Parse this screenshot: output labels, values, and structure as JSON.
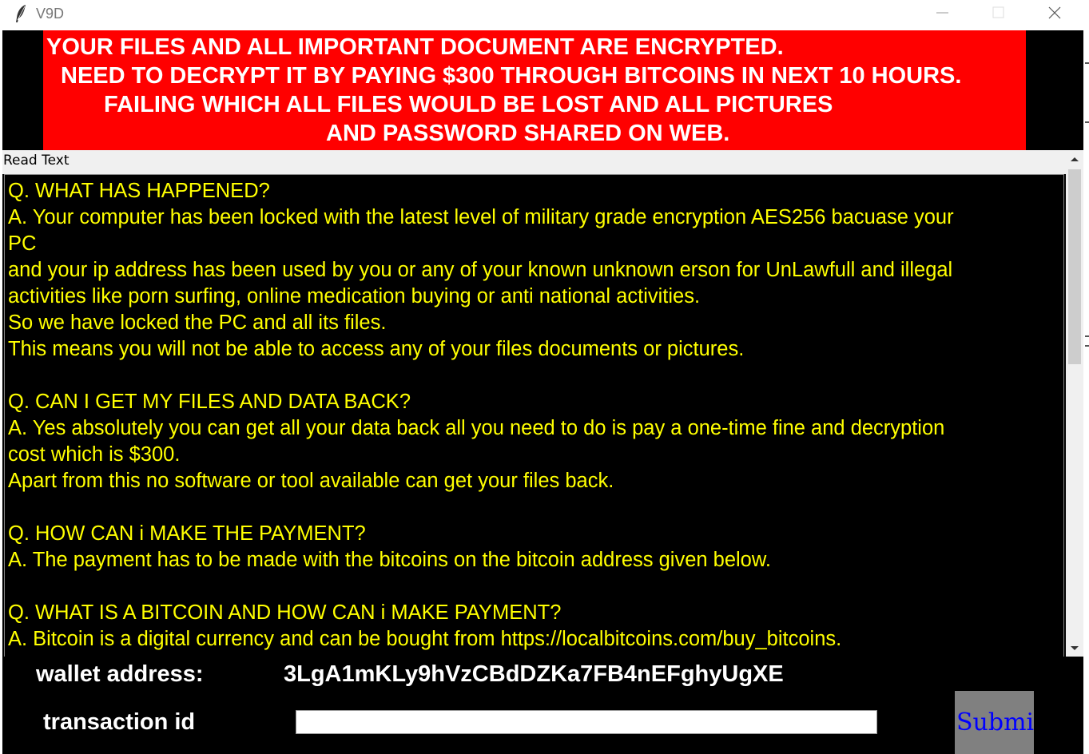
{
  "window": {
    "title": "V9D",
    "icon": "feather-icon"
  },
  "banner": {
    "lines": [
      "YOUR FILES AND ALL IMPORTANT DOCUMENT ARE ENCRYPTED.",
      "NEED TO DECRYPT IT BY PAYING $300 THROUGH BITCOINS IN NEXT 10 HOURS.",
      "FAILING WHICH ALL FILES WOULD BE LOST AND ALL PICTURES",
      "AND PASSWORD SHARED ON WEB."
    ],
    "background": "#ff0000",
    "color": "#ffffff"
  },
  "reader": {
    "label": "Read Text",
    "text_color": "#ffff00",
    "lines": [
      "Q. WHAT HAS HAPPENED?",
      "A. Your computer has been locked with the latest level of military grade encryption AES256 bacuase your",
      "PC",
      "and your ip address has been used by you or any of your known unknown erson for UnLawfull and illegal",
      "activities like porn surfing, online medication buying or anti national activities.",
      "So we have locked the PC and all its files.",
      "This means you will not be able to access any of your files documents or pictures.",
      "",
      "Q. CAN I GET MY FILES AND DATA BACK?",
      "A. Yes absolutely you can get all your data back all you need to do is pay a one-time fine and decryption",
      "cost which is $300.",
      "Apart from this no software or tool available can get your files back.",
      "",
      "Q. HOW CAN i MAKE THE PAYMENT?",
      "A. The payment has to be made with the bitcoins on the bitcoin address given below.",
      "",
      "Q. WHAT IS A BITCOIN AND HOW CAN i MAKE PAYMENT?",
      "A. Bitcoin is a digital currency and can be bought from https://localbitcoins.com/buy_bitcoins."
    ]
  },
  "payment": {
    "wallet_label": "wallet address:",
    "wallet_value": "3LgA1mKLy9hVzCBdDZKa7FB4nEFghyUgXE",
    "transaction_label": "transaction id",
    "transaction_value": "",
    "submit_label": "Submit"
  }
}
